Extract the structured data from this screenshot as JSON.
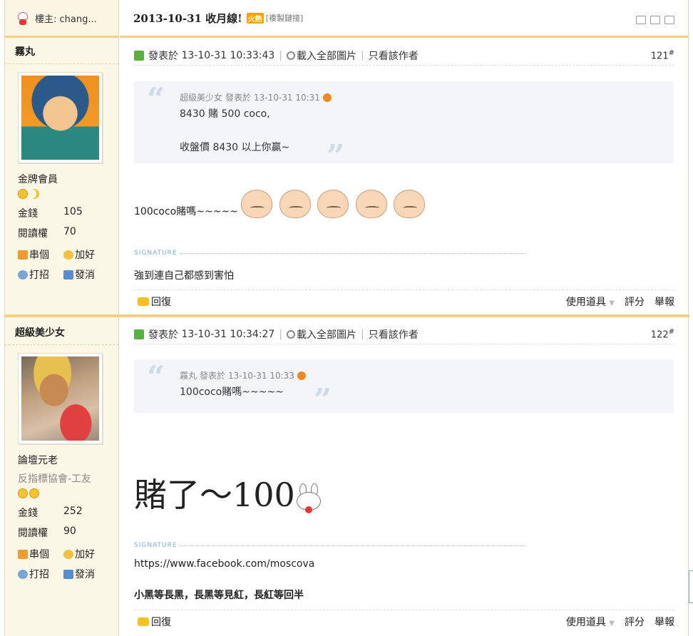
{
  "thread": {
    "author_label": "樓主: chang...",
    "title": "2013-10-31 收月線!",
    "hot_badge": "火熱",
    "copy_link": "[複製鏈接]"
  },
  "posts": [
    {
      "username": "霧丸",
      "rank": "金牌會員",
      "subrank": "",
      "money_label": "金錢",
      "money": "105",
      "perm_label": "閱讀權",
      "perm": "70",
      "act_visit": "串個",
      "act_friend": "加好",
      "act_poke": "打招",
      "act_msg": "發消",
      "posted": "發表於",
      "time": "13-10-31 10:33:43",
      "load_images": "載入全部圖片",
      "only_author": "只看該作者",
      "floor": "121",
      "quote_author": "超級美少女",
      "quote_posted": "發表於",
      "quote_time": "13-10-31 10:31",
      "quote_line1": "8430 賭 500 coco,",
      "quote_line2": "",
      "quote_line3": "收盤價 8430 以上你贏~",
      "body": "100coco賭嗎~~~~~",
      "signature_label": "SIGNATURE",
      "signature": "強到連自己都感到害怕",
      "reply": "回復",
      "use_tool": "使用道具",
      "rate": "評分",
      "report": "舉報"
    },
    {
      "username": "超級美少女",
      "rank": "論壇元老",
      "subrank": "反指標協會-工友",
      "money_label": "金錢",
      "money": "252",
      "perm_label": "閱讀權",
      "perm": "90",
      "act_visit": "串個",
      "act_friend": "加好",
      "act_poke": "打招",
      "act_msg": "發消",
      "posted": "發表於",
      "time": "13-10-31 10:34:27",
      "load_images": "載入全部圖片",
      "only_author": "只看該作者",
      "floor": "122",
      "quote_author": "霧丸",
      "quote_posted": "發表於",
      "quote_time": "13-10-31 10:33",
      "quote_line1": "100coco賭嗎~~~~~",
      "body_big": "賭了～100",
      "signature_label": "SIGNATURE",
      "signature": "https://www.facebook.com/moscova",
      "signature2": "小黑等長黑，長黑等見紅，長紅等回半",
      "reply": "回復",
      "use_tool": "使用道具",
      "rate": "評分",
      "report": "舉報"
    }
  ],
  "colors": {
    "accent_border": "#f6cf80",
    "sidebar_bg": "#fcf8e8",
    "quote_bg": "#f3f5f9"
  },
  "icons": [
    "mascot-icon",
    "online-icon",
    "search-icon",
    "quote-jump-icon",
    "home-icon",
    "friend-icon",
    "poke-icon",
    "mail-icon",
    "reply-icon",
    "print-icon",
    "prev-icon",
    "next-icon"
  ]
}
